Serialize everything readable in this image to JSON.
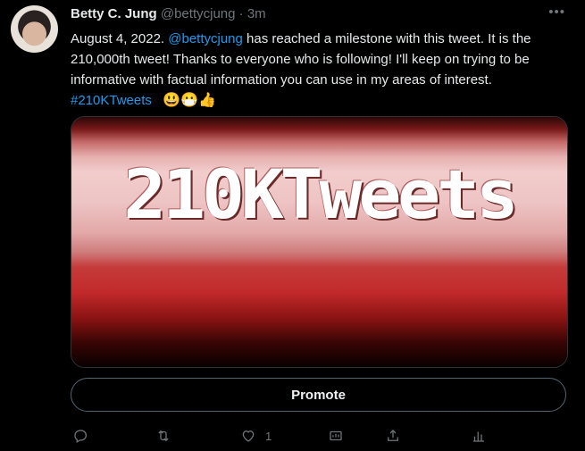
{
  "tweet": {
    "author": {
      "name": "Betty C. Jung",
      "handle": "@bettycjung",
      "separator": "·",
      "time": "3m"
    },
    "more_label": "•••",
    "text": {
      "part1": "August 4, 2022.  ",
      "mention": "@bettycjung",
      "part2": "  has reached a milestone with this tweet. It is the 210,000th tweet! Thanks to everyone who is following! I'll keep on trying to be informative with factual information you can use in my areas of interest.  ",
      "hashtag": "#210KTweets",
      "emojis": "😃😷👍"
    },
    "media": {
      "banner_text": "210KTweets"
    },
    "promote_label": "Promote",
    "actions": {
      "reply": {
        "icon": "reply-icon"
      },
      "retweet": {
        "icon": "retweet-icon"
      },
      "like": {
        "icon": "heart-icon",
        "count": "1"
      },
      "analytics": {
        "icon": "analytics-icon"
      },
      "share": {
        "icon": "share-icon"
      },
      "views": {
        "icon": "bar-chart-icon"
      }
    }
  },
  "colors": {
    "background": "#000000",
    "text": "#e7e9ea",
    "secondary": "#71767b",
    "link": "#1d9bf0",
    "border": "#2f3336"
  }
}
